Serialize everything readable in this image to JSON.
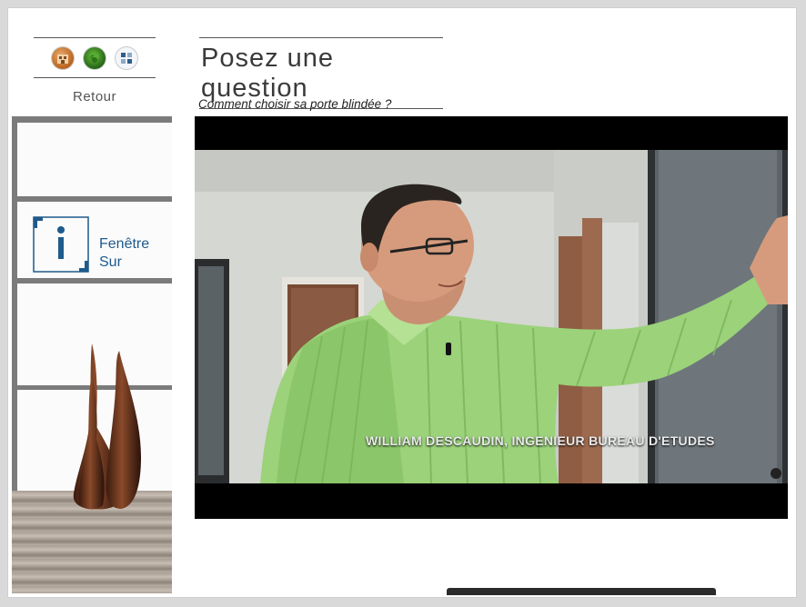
{
  "sidebar": {
    "icons": [
      {
        "name": "house-facade-icon"
      },
      {
        "name": "garden-plant-icon"
      },
      {
        "name": "window-icon"
      }
    ],
    "back_label": "Retour"
  },
  "logo": {
    "line1": "Fenêtre",
    "line2": "Sur",
    "color": "#1e5a8c"
  },
  "main": {
    "title": "Posez une question",
    "question": "Comment choisir sa porte blindée ?",
    "video": {
      "caption": "WILLIAM DESCAUDIN,  INGENIEUR BUREAU D'ETUDES"
    }
  },
  "colors": {
    "shirt_green": "#9bd27a",
    "frame_gray": "#d9d9d9",
    "rule_gray": "#555555"
  }
}
